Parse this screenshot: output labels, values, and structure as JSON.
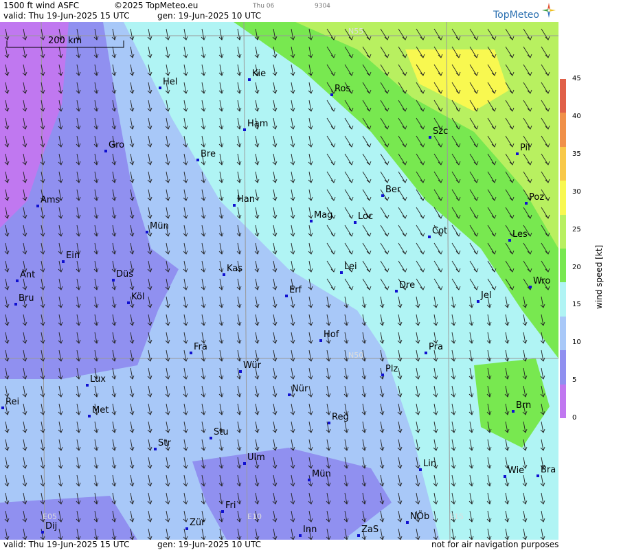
{
  "header": {
    "product": "1500 ft wind ASFC",
    "copyright": "©2025 TopMeteo.eu",
    "day": "Thu 06",
    "code": "9304",
    "valid": "valid:  Thu  19-Jun-2025  15 UTC",
    "gen": "gen: 19-Jun-2025 10 UTC",
    "logo": "TopMeteo"
  },
  "scale_bar": "200 km",
  "grid_labels": [
    "N55",
    "N50",
    "E05",
    "E10",
    "E15"
  ],
  "cities": [
    "Hel",
    "Kie",
    "Ros",
    "Ham",
    "Szc",
    "Gro",
    "Bre",
    "Pil",
    "Ams",
    "Han",
    "Ber",
    "Poz",
    "Mag",
    "Loc",
    "Mün",
    "Cot",
    "Les",
    "Ein",
    "Kas",
    "Lei",
    "Ant",
    "Düs",
    "Wro",
    "Dre",
    "Erf",
    "Köl",
    "Bru",
    "Jel",
    "Hof",
    "Fra",
    "Pra",
    "Würz",
    "Plz",
    "Lux",
    "Nür",
    "Rei",
    "Met",
    "Reg",
    "Brn",
    "Stu",
    "Str",
    "Lin",
    "Ulm",
    "Wie",
    "Bra",
    "Mün2",
    "Fri",
    "Zür",
    "Dij",
    "NÖb",
    "Inn",
    "ZaS"
  ],
  "city_labels": {
    "Hel": "Hel",
    "Kie": "Kie",
    "Ros": "Ros",
    "Ham": "Ham",
    "Szc": "Szc",
    "Gro": "Gro",
    "Bre": "Bre",
    "Pil": "Pil",
    "Ams": "Ams",
    "Han": "Han",
    "Ber": "Ber",
    "Poz": "Poz",
    "Mag": "Mag",
    "Loc": "Loc",
    "Mün": "Mün",
    "Cot": "Cot",
    "Les": "Les",
    "Ein": "Ein",
    "Kas": "Kas",
    "Lei": "Lei",
    "Ant": "Ant",
    "Düs": "Düs",
    "Wro": "Wro",
    "Dre": "Dre",
    "Erf": "Erf",
    "Köl": "Köl",
    "Bru": "Bru",
    "Jel": "Jel",
    "Hof": "Hof",
    "Fra": "Fra",
    "Pra": "Pra",
    "Würz": "Wür",
    "Plz": "Plz",
    "Lux": "Lux",
    "Nür": "Nür",
    "Rei": "Rei",
    "Met": "Met",
    "Reg": "Reg",
    "Brn": "Brn",
    "Stu": "Stu",
    "Str": "Str",
    "Lin": "Lin",
    "Ulm": "Ulm",
    "Wie": "Wie",
    "Bra": "Bra",
    "Mün2": "Mün",
    "Fri": "Fri",
    "Zür": "Zür",
    "Dij": "Dij",
    "NÖb": "NÖb",
    "Inn": "Inn",
    "ZaS": "ZaS"
  },
  "legend": {
    "title": "wind speed [kt]",
    "ticks": [
      "45",
      "40",
      "35",
      "30",
      "25",
      "20",
      "15",
      "10",
      "5",
      "0"
    ],
    "colors": [
      "#e06048",
      "#f09048",
      "#f8c848",
      "#f8f850",
      "#b8f060",
      "#78e850",
      "#b0f4f4",
      "#a8c8f8",
      "#9090f0",
      "#c078f0"
    ]
  },
  "footer": {
    "valid": "valid:  Thu  19-Jun-2025  15 UTC",
    "gen": "gen: 19-Jun-2025 10 UTC",
    "note": "not for air navigation purposes"
  }
}
